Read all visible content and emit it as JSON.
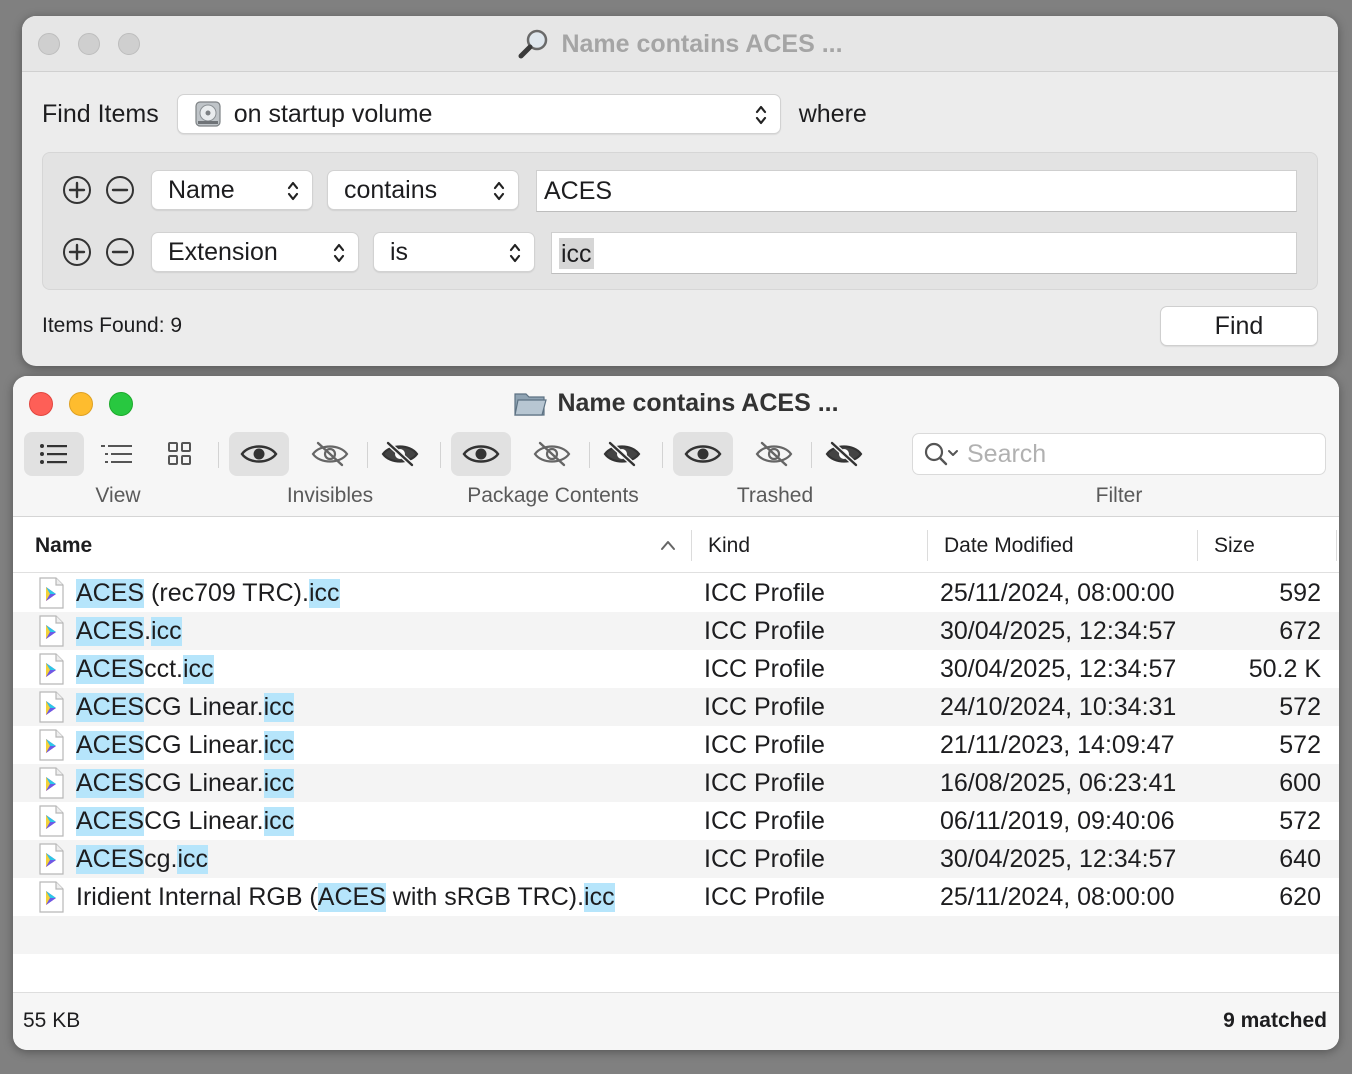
{
  "find_window": {
    "title": "Name contains ACES ...",
    "find_items_label": "Find Items",
    "scope_value": "on startup volume",
    "where_label": "where",
    "criteria": [
      {
        "attribute": "Name",
        "operator": "contains",
        "value": "ACES"
      },
      {
        "attribute": "Extension",
        "operator": "is",
        "value": "icc"
      }
    ],
    "items_found": "Items Found: 9",
    "find_button": "Find"
  },
  "results_window": {
    "title": "Name contains ACES ...",
    "toolbar": {
      "view_label": "View",
      "invisibles_label": "Invisibles",
      "package_contents_label": "Package Contents",
      "trashed_label": "Trashed",
      "filter_label": "Filter",
      "search_placeholder": "Search"
    },
    "columns": {
      "name": "Name",
      "kind": "Kind",
      "date": "Date Modified",
      "size": "Size"
    },
    "rows": [
      {
        "name": [
          [
            "ACES",
            true
          ],
          [
            " (rec709 TRC).",
            false
          ],
          [
            "icc",
            true
          ]
        ],
        "kind": "ICC Profile",
        "date": "25/11/2024, 08:00:00",
        "size": "592"
      },
      {
        "name": [
          [
            "ACES",
            true
          ],
          [
            ".",
            false
          ],
          [
            "icc",
            true
          ]
        ],
        "kind": "ICC Profile",
        "date": "30/04/2025, 12:34:57",
        "size": "672"
      },
      {
        "name": [
          [
            "ACES",
            true
          ],
          [
            "cct.",
            false
          ],
          [
            "icc",
            true
          ]
        ],
        "kind": "ICC Profile",
        "date": "30/04/2025, 12:34:57",
        "size": "50.2 K"
      },
      {
        "name": [
          [
            "ACES",
            true
          ],
          [
            "CG Linear.",
            false
          ],
          [
            "icc",
            true
          ]
        ],
        "kind": "ICC Profile",
        "date": "24/10/2024, 10:34:31",
        "size": "572"
      },
      {
        "name": [
          [
            "ACES",
            true
          ],
          [
            "CG Linear.",
            false
          ],
          [
            "icc",
            true
          ]
        ],
        "kind": "ICC Profile",
        "date": "21/11/2023, 14:09:47",
        "size": "572"
      },
      {
        "name": [
          [
            "ACES",
            true
          ],
          [
            "CG Linear.",
            false
          ],
          [
            "icc",
            true
          ]
        ],
        "kind": "ICC Profile",
        "date": "16/08/2025, 06:23:41",
        "size": "600"
      },
      {
        "name": [
          [
            "ACES",
            true
          ],
          [
            "CG Linear.",
            false
          ],
          [
            "icc",
            true
          ]
        ],
        "kind": "ICC Profile",
        "date": "06/11/2019, 09:40:06",
        "size": "572"
      },
      {
        "name": [
          [
            "ACES",
            true
          ],
          [
            "cg.",
            false
          ],
          [
            "icc",
            true
          ]
        ],
        "kind": "ICC Profile",
        "date": "30/04/2025, 12:34:57",
        "size": "640"
      },
      {
        "name": [
          [
            "Iridient Internal RGB (",
            false
          ],
          [
            "ACES",
            true
          ],
          [
            " with sRGB TRC).",
            false
          ],
          [
            "icc",
            true
          ]
        ],
        "kind": "ICC Profile",
        "date": "25/11/2024, 08:00:00",
        "size": "620"
      }
    ],
    "footer_left": "55 KB",
    "footer_right": "9 matched"
  },
  "colors": {
    "highlight": "#b6e5fb",
    "close": "#fe5f57",
    "minimize": "#febc2e",
    "zoom": "#28c840"
  },
  "icons": [
    "magnifier-icon",
    "disk-icon",
    "folder-icon",
    "eye-icon",
    "eye-slash-icon",
    "list-icon",
    "grid-icon",
    "icc-file-icon"
  ]
}
